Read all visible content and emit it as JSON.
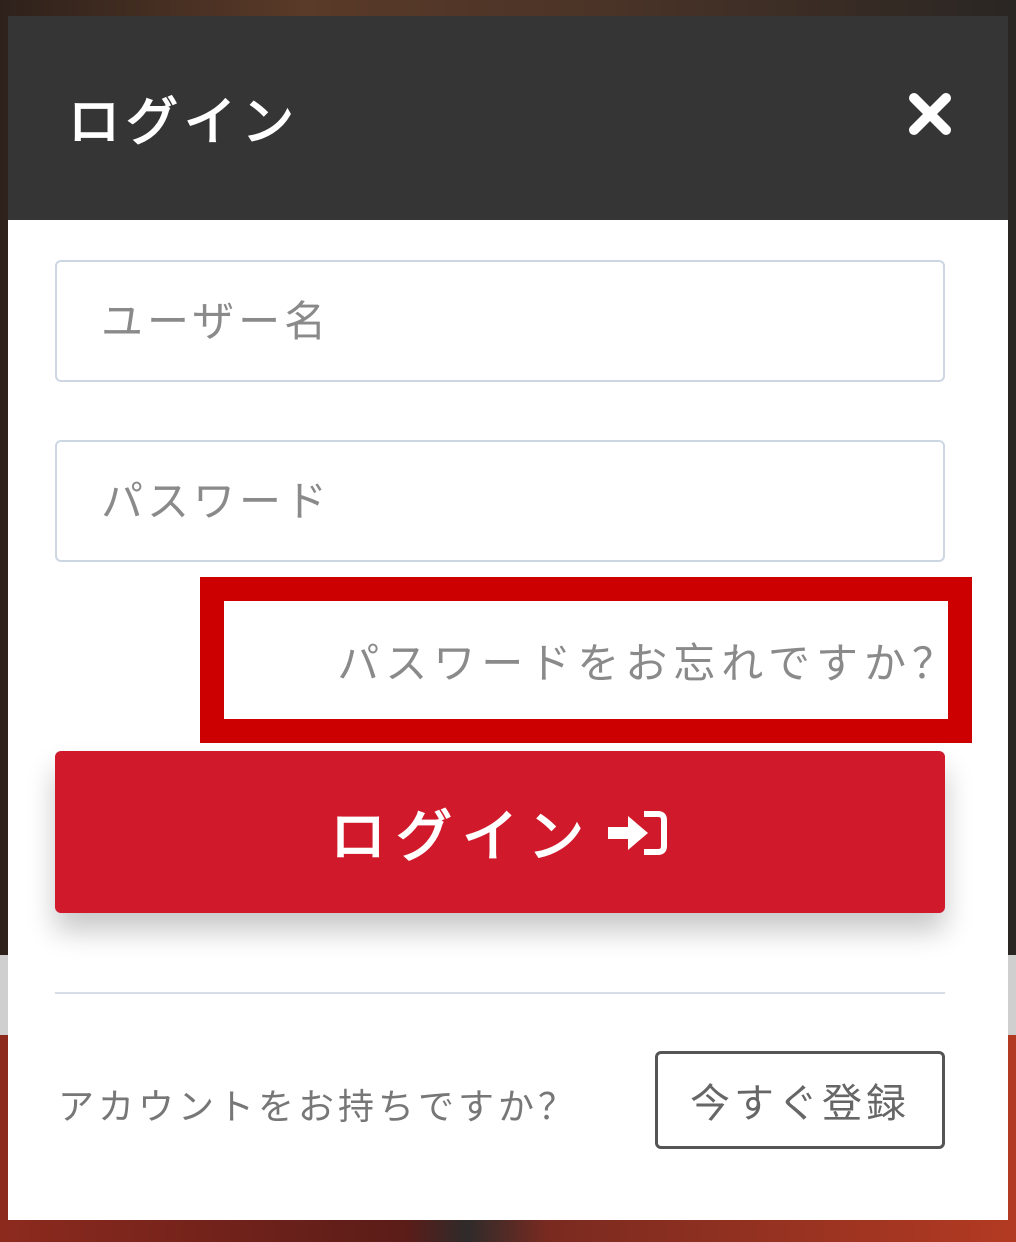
{
  "modal": {
    "title": "ログイン",
    "close_icon": "close-icon"
  },
  "form": {
    "username_placeholder": "ユーザー名",
    "username_value": "",
    "password_placeholder": "パスワード",
    "password_value": "",
    "forgot_password": "パスワードをお忘れですか？",
    "login_label": "ログイン",
    "login_icon": "sign-in-icon"
  },
  "footer": {
    "account_question": "アカウントをお持ちですか？",
    "register_label": "今すぐ登録"
  },
  "colors": {
    "header_bg": "#353535",
    "primary": "#d0192b",
    "highlight": "#cc0000"
  }
}
